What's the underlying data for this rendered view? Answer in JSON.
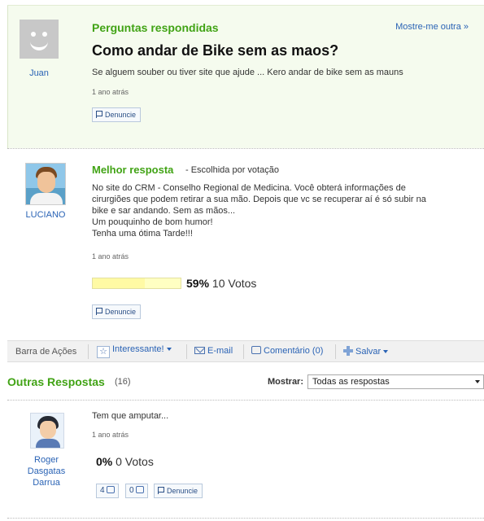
{
  "question": {
    "section_title": "Perguntas respondidas",
    "more_link": "Mostre-me outra »",
    "author": "Juan",
    "title": "Como andar de Bike sem as maos?",
    "body": "Se alguem souber ou tiver site que ajude ... Kero andar de bike sem as mauns",
    "time": "1 ano atrás",
    "report_label": "Denuncie"
  },
  "best_answer": {
    "title": "Melhor resposta",
    "subtitle": "- Escolhida por votação",
    "author": "LUCIANO",
    "body_lines": [
      "No site do CRM - Conselho Regional de Medicina. Você obterá informações de",
      "cirurgiões que podem retirar a sua mão. Depois que vc se recuperar aí é só subir na",
      "bike e sar andando. Sem as mãos...",
      "Um pouquinho de bom humor!",
      "Tenha uma ótima Tarde!!!"
    ],
    "time": "1 ano atrás",
    "vote_percent_label": "59%",
    "vote_fraction": 0.59,
    "votes_label": "10 Votos",
    "report_label": "Denuncie"
  },
  "action_bar": {
    "label": "Barra de Ações",
    "interesting": "Interessante!",
    "email": "E-mail",
    "comment": "Comentário (0)",
    "save": "Salvar"
  },
  "other_answers": {
    "title": "Outras Respostas",
    "count": "(16)",
    "show_label": "Mostrar:",
    "filter_value": "Todas as respostas",
    "items": [
      {
        "author_lines": [
          "Roger",
          "Dasgatas",
          "Darrua"
        ],
        "body": "Tem que amputar...",
        "time": "1 ano atrás",
        "vote_percent_label": "0%",
        "votes_label": "0 Votos",
        "thumbs_up_count": "4",
        "thumbs_down_count": "0",
        "report_label": "Denuncie"
      }
    ]
  },
  "colors": {
    "accent_green": "#41a315",
    "link_blue": "#2a63b5",
    "question_bg": "#f5fbee"
  }
}
